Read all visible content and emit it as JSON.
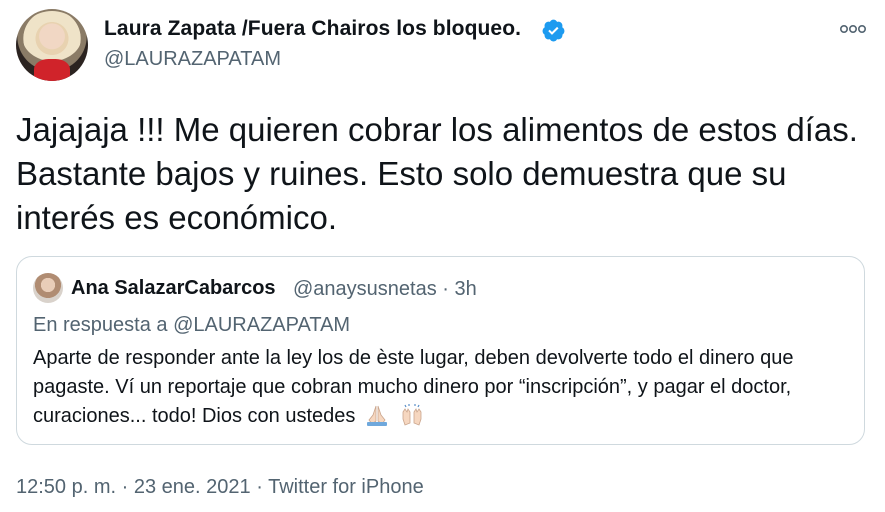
{
  "author": {
    "display_name": "Laura Zapata /Fuera Chairos los bloqueo.",
    "handle": "@LAURAZAPATAM",
    "verified": true,
    "avatar_icon": "profile-photo"
  },
  "tweet": {
    "text": "Jajajaja !!! Me quieren cobrar los alimentos de estos días. Bastante bajos y ruines. Esto solo demuestra que su interés es económico."
  },
  "quoted": {
    "display_name": "Ana SalazarCabarcos",
    "handle": "@anaysusnetas",
    "separator": "·",
    "time": "3h",
    "reply_prefix": "En respuesta a",
    "reply_to": "@LAURAZAPATAM",
    "text": "Aparte de responder ante la ley los de èste lugar, deben devolverte todo el dinero que pagaste. Ví un reportaje que cobran mucho dinero por “inscripción”, y pagar el doctor, curaciones... todo! Dios con ustedes",
    "emojis": [
      "folded-hands-emoji",
      "raising-hands-emoji"
    ]
  },
  "footer": {
    "time": "12:50 p. m.",
    "separator": "·",
    "date": "23 ene. 2021",
    "source": "Twitter for iPhone"
  },
  "colors": {
    "text": "#0f1419",
    "secondary": "#536471",
    "verified": "#1d9bf0",
    "border": "#cfd9de"
  }
}
